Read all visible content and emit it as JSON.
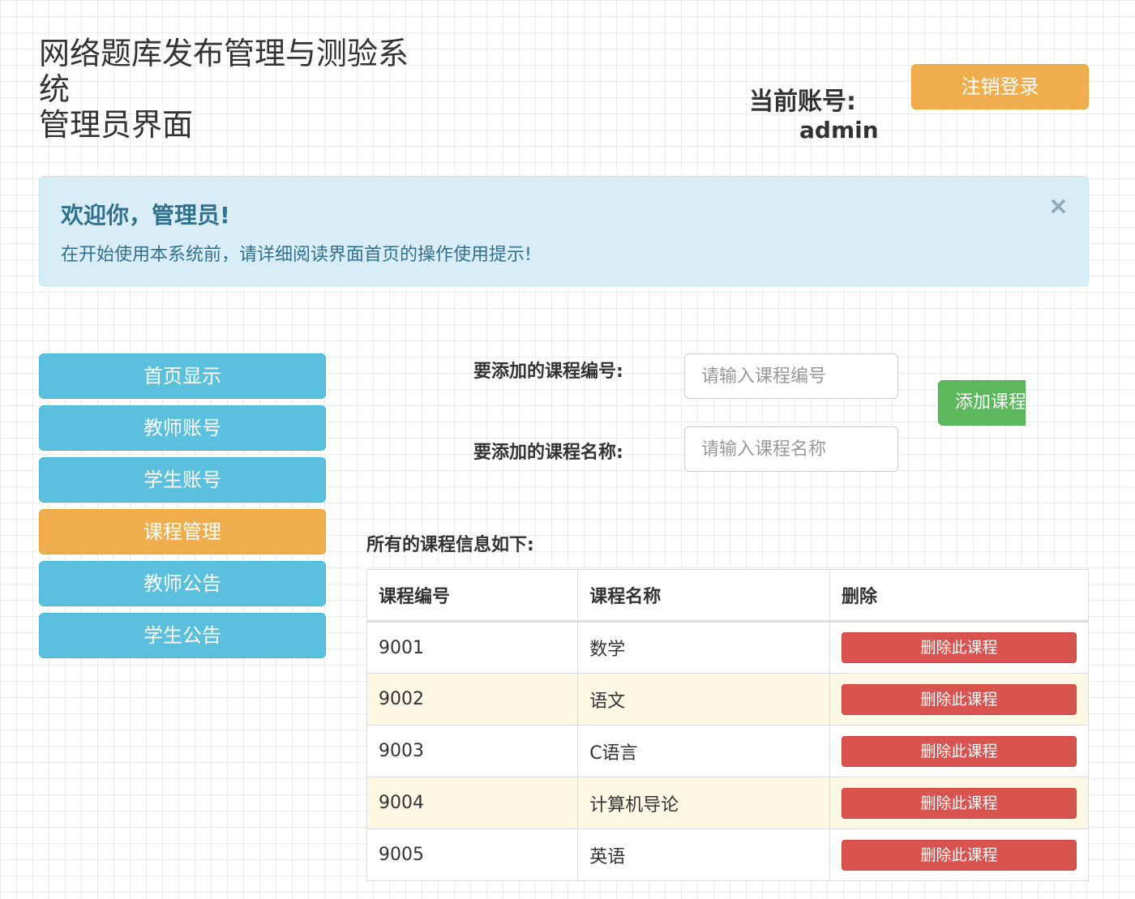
{
  "header": {
    "system_title_line1": "网络题库发布管理与测验系",
    "system_title_line2": "统",
    "subtitle": "管理员界面",
    "account_label": "当前账号:",
    "account_name": "admin",
    "logout_label": "注销登录"
  },
  "alert": {
    "title": "欢迎你，管理员!",
    "text": "在开始使用本系统前，请详细阅读界面首页的操作使用提示!",
    "close_symbol": "×"
  },
  "nav": {
    "items": [
      {
        "label": "首页显示"
      },
      {
        "label": "教师账号"
      },
      {
        "label": "学生账号"
      },
      {
        "label": "课程管理"
      },
      {
        "label": "教师公告"
      },
      {
        "label": "学生公告"
      }
    ],
    "active_index": 3
  },
  "form": {
    "course_id_label": "要添加的课程编号:",
    "course_id_placeholder": "请输入课程编号",
    "course_name_label": "要添加的课程名称:",
    "course_name_placeholder": "请输入课程名称",
    "add_button_label": "添加课程"
  },
  "table": {
    "caption": "所有的课程信息如下:",
    "headers": [
      "课程编号",
      "课程名称",
      "删除"
    ],
    "rows": [
      {
        "id": "9001",
        "name": "数学",
        "action": "删除此课程"
      },
      {
        "id": "9002",
        "name": "语文",
        "action": "删除此课程"
      },
      {
        "id": "9003",
        "name": "C语言",
        "action": "删除此课程"
      },
      {
        "id": "9004",
        "name": "计算机导论",
        "action": "删除此课程"
      },
      {
        "id": "9005",
        "name": "英语",
        "action": "删除此课程"
      }
    ]
  },
  "colors": {
    "primary_info": "#5bc0de",
    "warning": "#f0ad4e",
    "success": "#5cb85c",
    "danger": "#d9534f",
    "alert_bg": "#d9edf7",
    "alert_text": "#31708f",
    "stripe": "#fcf8e3"
  }
}
